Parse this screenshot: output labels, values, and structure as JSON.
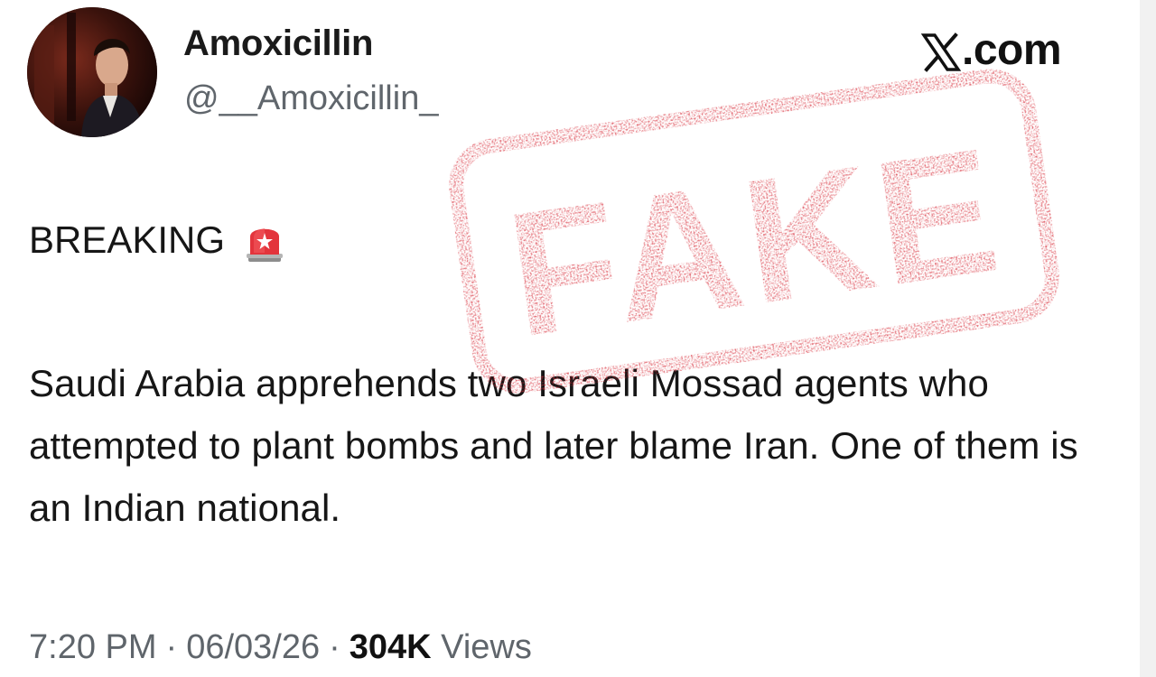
{
  "tweet": {
    "display_name": "Amoxicillin",
    "handle": "@__Amoxicillin_",
    "headline": "BREAKING",
    "body": "Saudi Arabia apprehends two Israeli Mossad agents who attempted to plant bombs and later blame Iran. One of them is an Indian national.",
    "time": "7:20 PM",
    "separator": "·",
    "date": "06/03/26",
    "views_count": "304K",
    "views_label": "Views"
  },
  "brand": {
    "text": ".com",
    "icon": "x-logo-icon"
  },
  "stamp": {
    "text": "FAKE",
    "color": "#d8303c"
  },
  "icons": {
    "headline_emoji": "police-siren-icon",
    "avatar": "profile-photo"
  },
  "colors": {
    "name_text": "#1a1a1a",
    "secondary_text": "#5f656b",
    "body_text": "#161616",
    "stamp_red": "#d8303c"
  }
}
